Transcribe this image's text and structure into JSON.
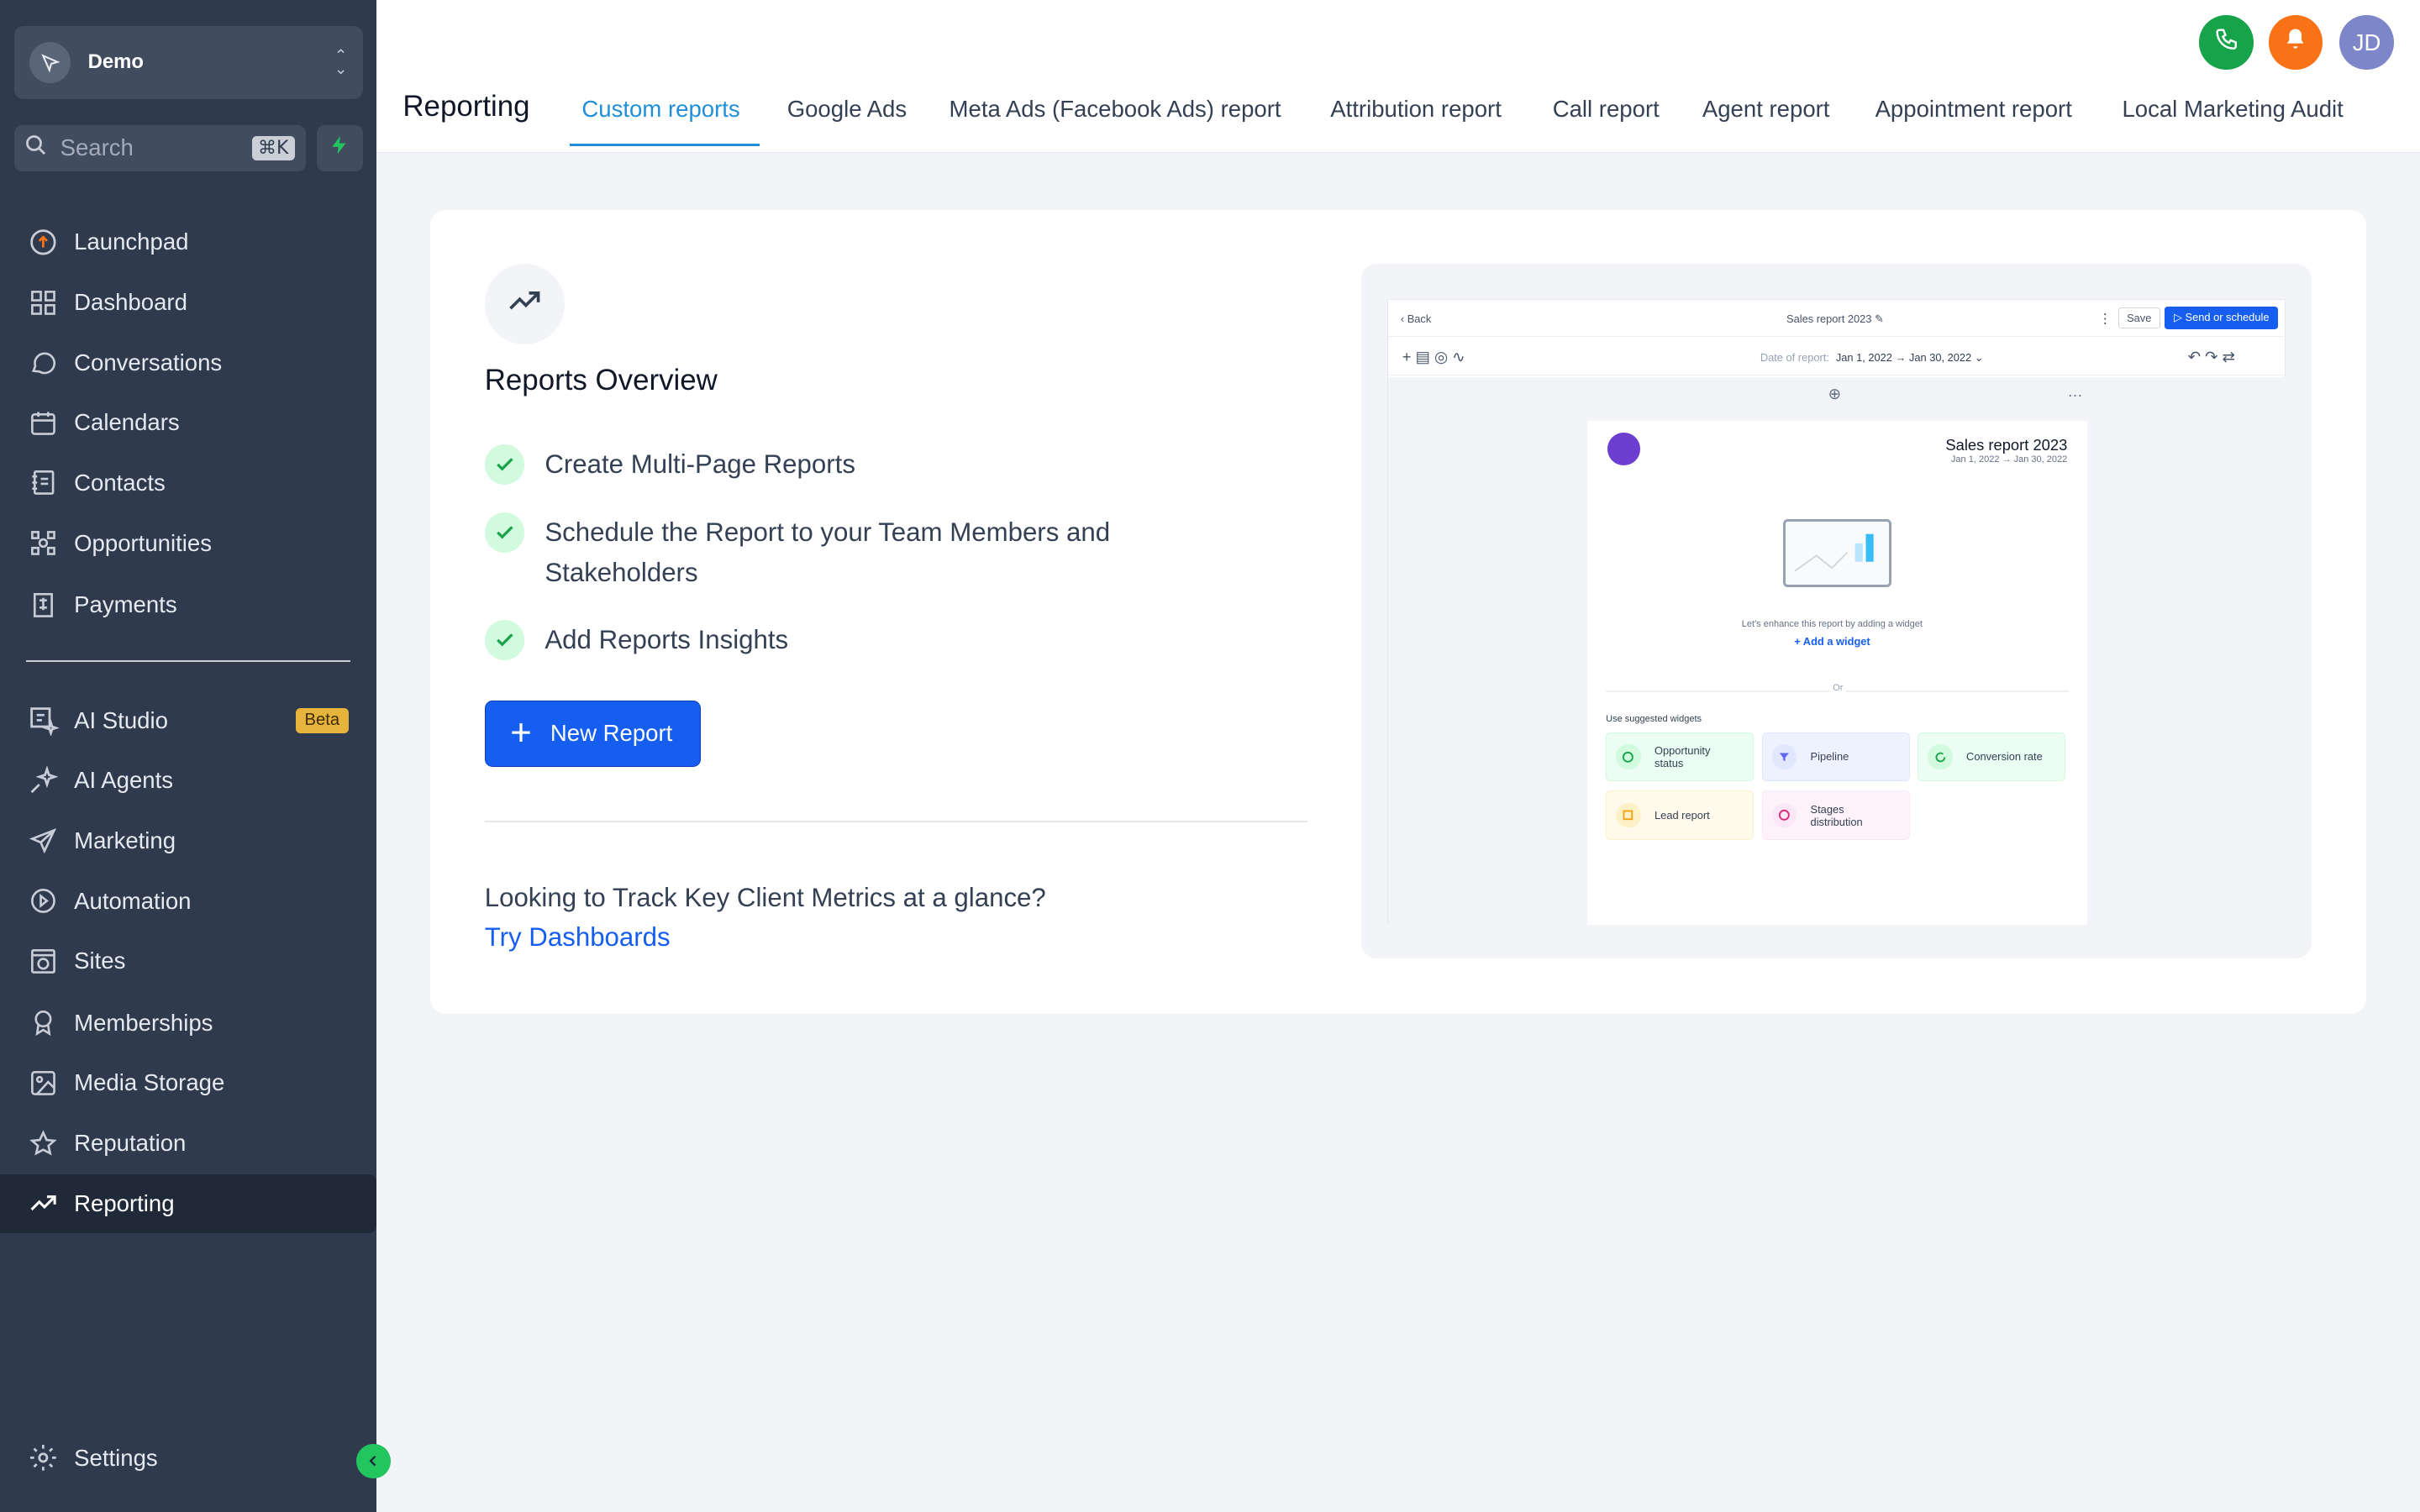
{
  "sidebar": {
    "account_name": "Demo",
    "search_placeholder": "Search",
    "search_shortcut": "⌘K",
    "nav_primary": [
      {
        "label": "Launchpad",
        "icon": "launchpad-icon"
      },
      {
        "label": "Dashboard",
        "icon": "dashboard-icon"
      },
      {
        "label": "Conversations",
        "icon": "chat-bubble-icon"
      },
      {
        "label": "Calendars",
        "icon": "calendar-icon"
      },
      {
        "label": "Contacts",
        "icon": "contacts-icon"
      },
      {
        "label": "Opportunities",
        "icon": "opportunities-icon"
      },
      {
        "label": "Payments",
        "icon": "receipt-icon"
      }
    ],
    "nav_secondary": [
      {
        "label": "AI Studio",
        "icon": "ai-studio-icon",
        "badge": "Beta"
      },
      {
        "label": "AI Agents",
        "icon": "sparkle-icon"
      },
      {
        "label": "Marketing",
        "icon": "send-icon"
      },
      {
        "label": "Automation",
        "icon": "play-circle-icon"
      },
      {
        "label": "Sites",
        "icon": "globe-icon"
      },
      {
        "label": "Memberships",
        "icon": "badge-icon"
      },
      {
        "label": "Media Storage",
        "icon": "image-icon"
      },
      {
        "label": "Reputation",
        "icon": "star-icon"
      },
      {
        "label": "Reporting",
        "icon": "trend-up-icon",
        "active": true
      }
    ],
    "settings_label": "Settings"
  },
  "header": {
    "title": "Reporting",
    "tabs": [
      {
        "label": "Custom reports",
        "active": true
      },
      {
        "label": "Google Ads"
      },
      {
        "label": "Meta Ads (Facebook Ads) report"
      },
      {
        "label": "Attribution report"
      },
      {
        "label": "Call report"
      },
      {
        "label": "Agent report"
      },
      {
        "label": "Appointment report"
      },
      {
        "label": "Local Marketing Audit"
      }
    ],
    "avatar_initials": "JD"
  },
  "overview": {
    "title": "Reports Overview",
    "features": [
      "Create Multi-Page Reports",
      "Schedule the Report to your Team Members and Stakeholders",
      "Add Reports Insights"
    ],
    "new_report_label": "New Report",
    "track_question": "Looking to Track Key Client Metrics at a glance?",
    "try_dashboards_label": "Try Dashboards"
  },
  "preview": {
    "back_label": "Back",
    "report_name": "Sales report 2023",
    "save_label": "Save",
    "send_label": "Send or schedule",
    "date_label": "Date of report:",
    "date_range": "Jan 1, 2022 → Jan 30, 2022",
    "page_title": "Sales report 2023",
    "page_dates": "Jan 1, 2022 → Jan 30, 2022",
    "enhance_text": "Let's enhance this report by adding a widget",
    "add_widget_label": "Add a widget",
    "or_label": "Or",
    "suggested_label": "Use suggested widgets",
    "widgets": [
      "Opportunity status",
      "Pipeline",
      "Conversion rate",
      "Lead report",
      "Stages distribution"
    ]
  },
  "colors": {
    "sidebar_bg": "#2f3a4d",
    "primary": "#155eef",
    "tab_active": "#1f8fd8",
    "phone_green": "#16a34a",
    "bell_orange": "#f97316",
    "avatar_purple": "#7c86c8"
  }
}
